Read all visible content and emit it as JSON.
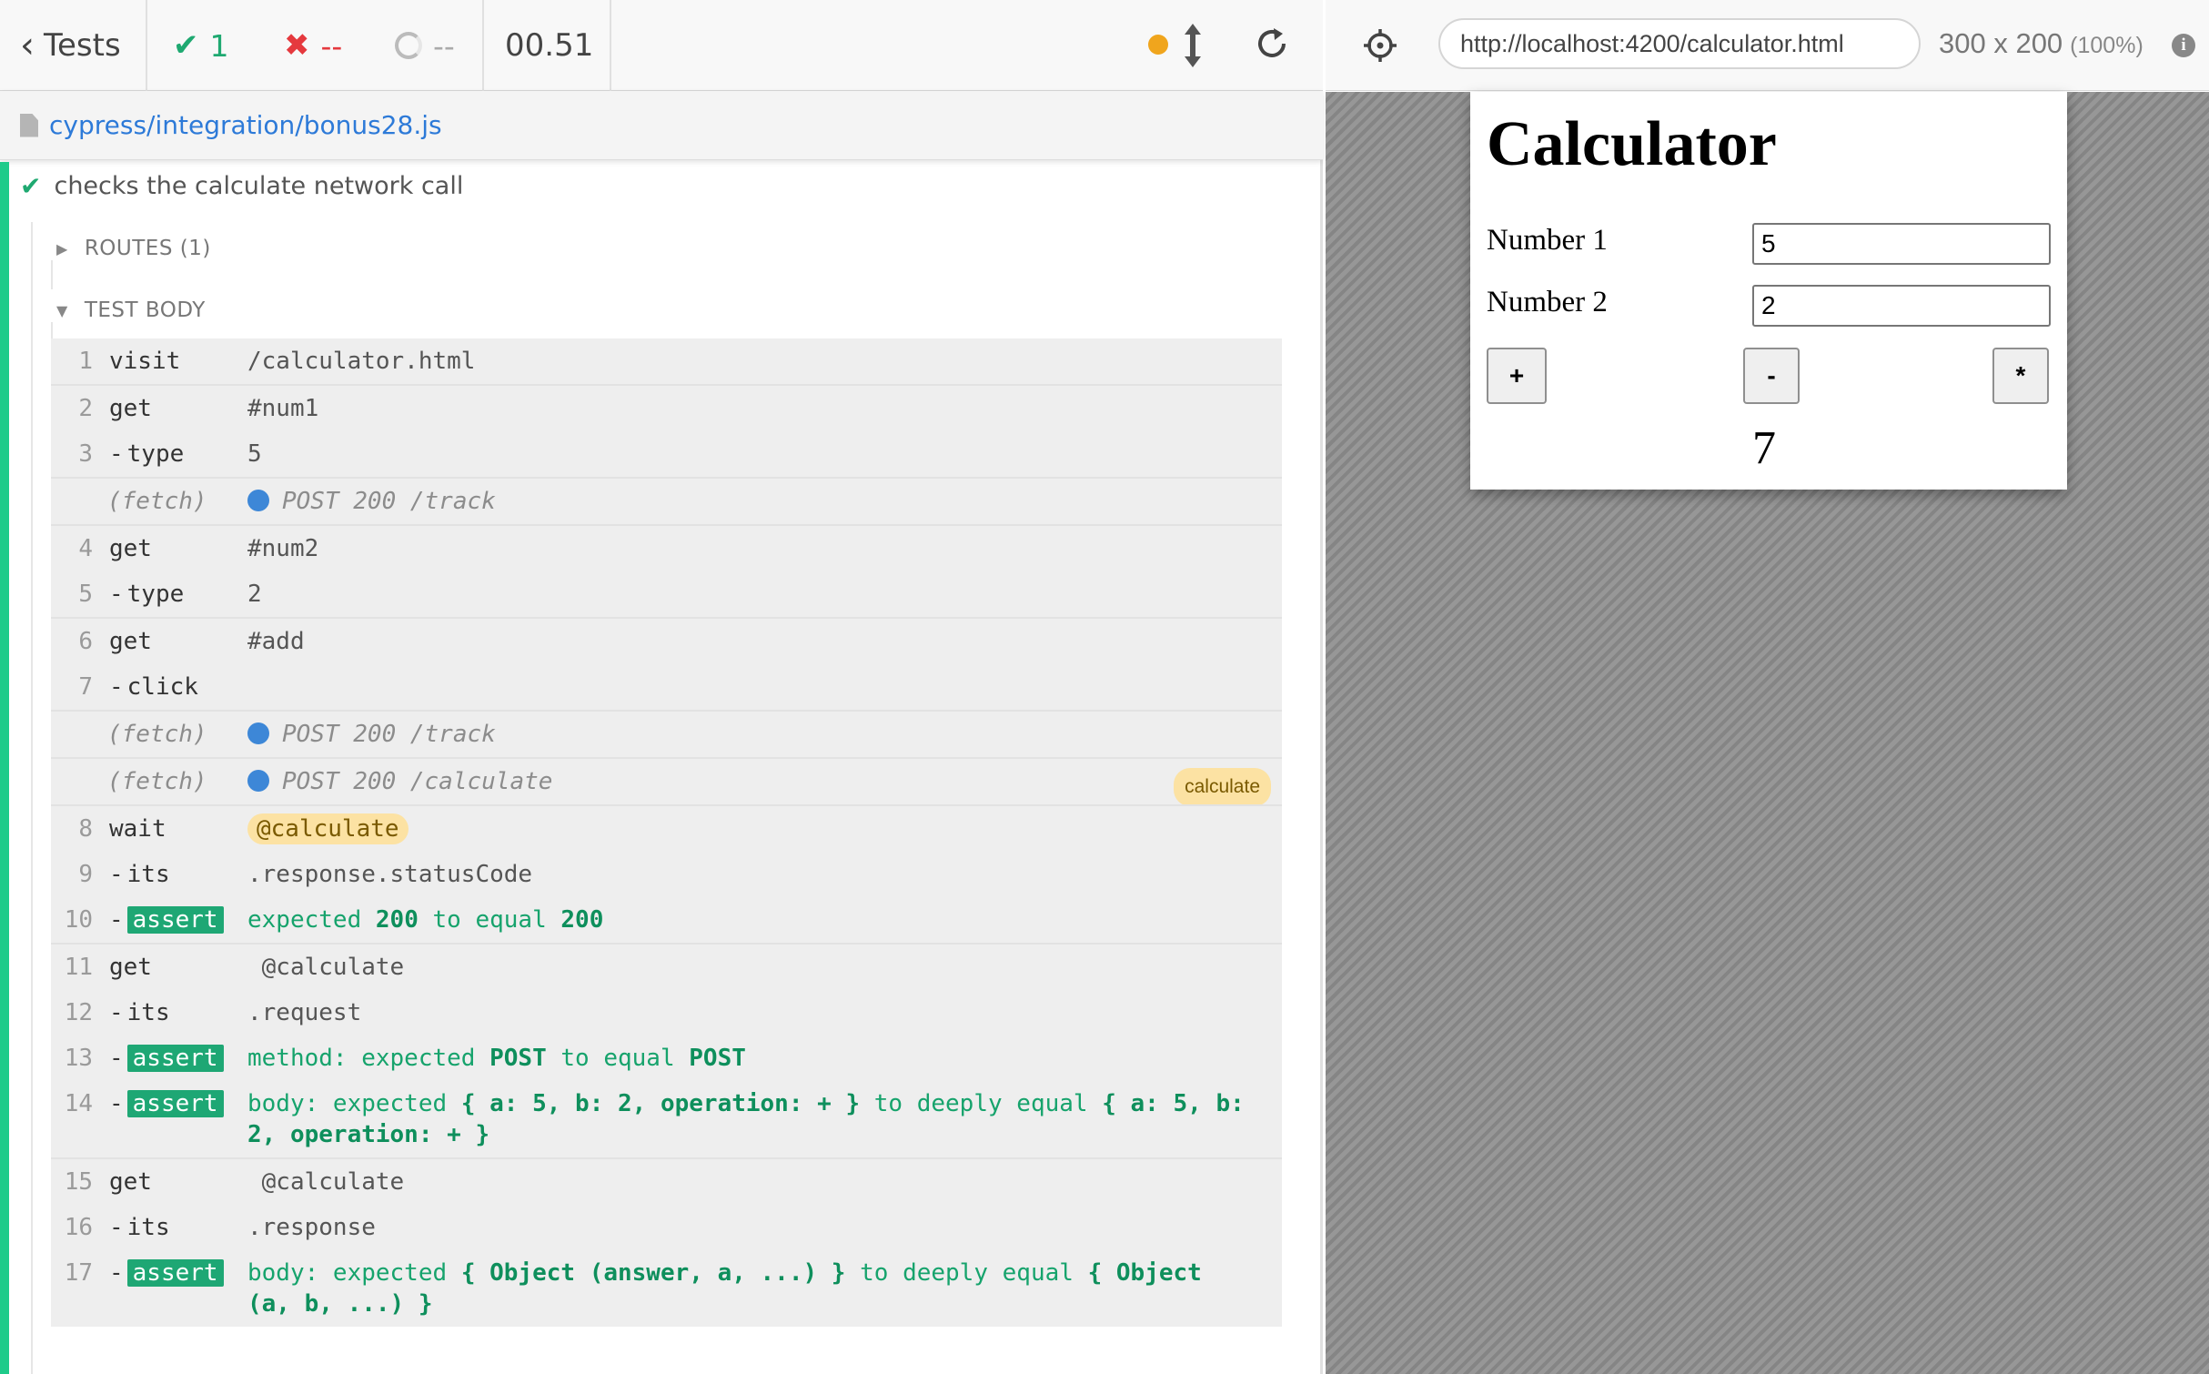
{
  "topbar": {
    "tests_label": "Tests",
    "passed_count": "1",
    "failed_count": "--",
    "pending_count": "--",
    "duration": "00.51"
  },
  "spec": {
    "path": "cypress/integration/bonus28.js"
  },
  "test": {
    "title": "checks the calculate network call",
    "routes_label": "ROUTES (1)",
    "body_label": "TEST BODY"
  },
  "commands": [
    {
      "num": "1",
      "name": "visit",
      "msg": "/calculator.html"
    },
    {
      "num": "2",
      "name": "get",
      "msg": "#num1"
    },
    {
      "num": "3",
      "name": "type",
      "msg": "5"
    },
    {
      "num": "",
      "name": "(fetch)",
      "msg": "POST 200 /track"
    },
    {
      "num": "4",
      "name": "get",
      "msg": "#num2"
    },
    {
      "num": "5",
      "name": "type",
      "msg": "2"
    },
    {
      "num": "6",
      "name": "get",
      "msg": "#add"
    },
    {
      "num": "7",
      "name": "click",
      "msg": ""
    },
    {
      "num": "",
      "name": "(fetch)",
      "msg": "POST 200 /track"
    },
    {
      "num": "",
      "name": "(fetch)",
      "msg": "POST 200 /calculate",
      "badge": "calculate"
    },
    {
      "num": "8",
      "name": "wait",
      "msg": "@calculate"
    },
    {
      "num": "9",
      "name": "its",
      "msg": ".response.statusCode"
    },
    {
      "num": "10",
      "name": "assert",
      "msg_parts": [
        "expected ",
        "200",
        " to equal ",
        "200"
      ]
    },
    {
      "num": "11",
      "name": "get",
      "msg": "@calculate"
    },
    {
      "num": "12",
      "name": "its",
      "msg": ".request"
    },
    {
      "num": "13",
      "name": "assert",
      "msg_parts": [
        "method: expected ",
        "POST",
        " to equal ",
        "POST"
      ]
    },
    {
      "num": "14",
      "name": "assert",
      "msg_parts": [
        "body: expected ",
        "{ a: 5, b: 2, operation: + }",
        " to deeply equal ",
        "{ a: 5, b: 2, operation: + }"
      ]
    },
    {
      "num": "15",
      "name": "get",
      "msg": "@calculate"
    },
    {
      "num": "16",
      "name": "its",
      "msg": ".response"
    },
    {
      "num": "17",
      "name": "assert",
      "msg_parts": [
        "body: expected ",
        "{ Object (answer, a, ...) }",
        " to deeply equal ",
        "{ Object (a, b, ...) }"
      ]
    }
  ],
  "aut": {
    "url": "http://localhost:4200/calculator.html",
    "viewport_size": "300 x 200",
    "viewport_scale": "(100%)"
  },
  "calculator": {
    "title": "Calculator",
    "num1_label": "Number 1",
    "num1_value": "5",
    "num2_label": "Number 2",
    "num2_value": "2",
    "add_label": "+",
    "sub_label": "-",
    "mul_label": "*",
    "result": "7"
  },
  "colors": {
    "pass": "#1fa971",
    "fail": "#e5393e",
    "accent_bar": "#1ecb8a",
    "link": "#2d7ad8",
    "alias_bg": "#fce2a3"
  }
}
